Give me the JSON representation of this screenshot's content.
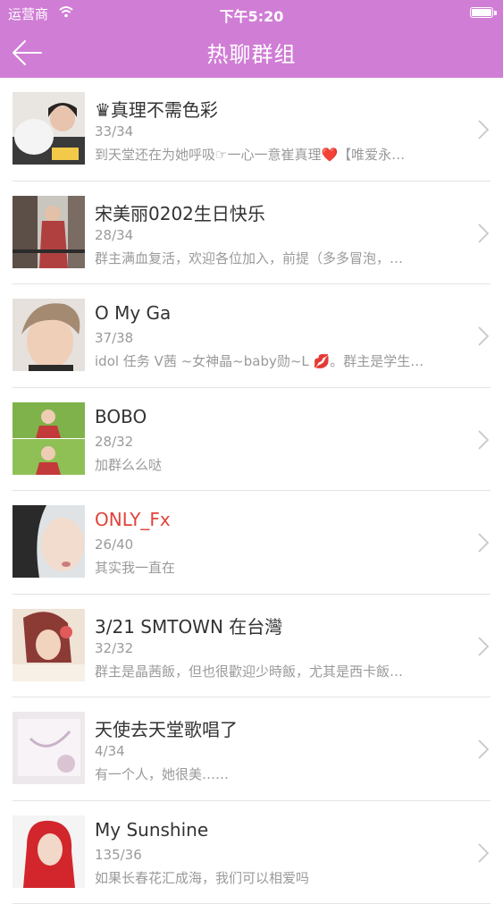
{
  "status_bar": {
    "carrier": "运营商",
    "time": "下午5:20"
  },
  "nav": {
    "title": "热聊群组"
  },
  "groups": [
    {
      "name": "♛真理不需色彩",
      "count": "33/34",
      "preview": "到天堂还在为她呼吸☞一心一意崔真理❤️【唯爱永…",
      "highlight": false
    },
    {
      "name": "宋美丽0202生日快乐",
      "count": "28/34",
      "preview": "群主满血复活，欢迎各位加入，前提（多多冒泡，…",
      "highlight": false
    },
    {
      "name": "O My Ga",
      "count": "37/38",
      "preview": "idol 任务 V茜 ~女神晶~baby勋~L 💋。群主是学生…",
      "highlight": false
    },
    {
      "name": "BOBO",
      "count": "28/32",
      "preview": "加群么么哒",
      "highlight": false
    },
    {
      "name": "ONLY_Fx",
      "count": "26/40",
      "preview": "其实我一直在",
      "highlight": true
    },
    {
      "name": "3/21 SMTOWN 在台灣",
      "count": "32/32",
      "preview": "群主是晶茜飯，但也很歡迎少時飯，尤其是西卡飯…",
      "highlight": false
    },
    {
      "name": "天使去天堂歌唱了",
      "count": "4/34",
      "preview": "有一个人，她很美……",
      "highlight": false
    },
    {
      "name": "My Sunshine",
      "count": "135/36",
      "preview": "如果长春花汇成海，我们可以相爱吗",
      "highlight": false
    }
  ],
  "colors": {
    "header": "#d07dd5",
    "highlight_name": "#e0433b",
    "secondary_text": "#9a9a9a"
  }
}
